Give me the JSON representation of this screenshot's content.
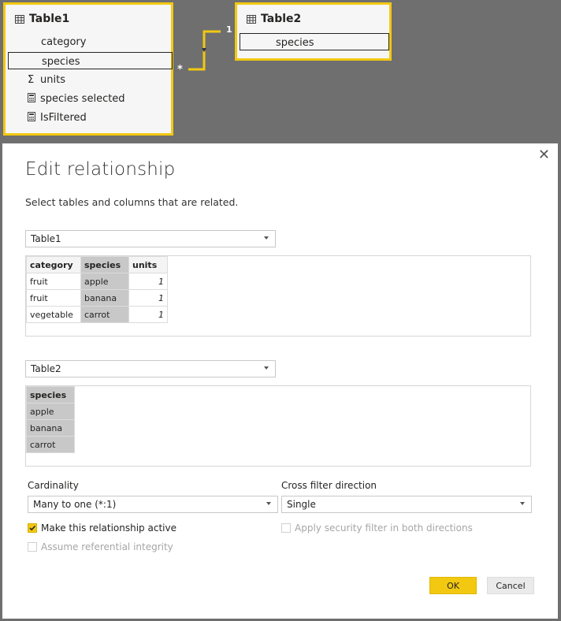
{
  "diagram": {
    "table1": {
      "title": "Table1",
      "fields": [
        {
          "label": "category",
          "icon": "none"
        },
        {
          "label": "species",
          "icon": "none",
          "selected": true
        },
        {
          "label": "units",
          "icon": "sigma-icon"
        },
        {
          "label": "species selected",
          "icon": "calculator-icon"
        },
        {
          "label": "IsFiltered",
          "icon": "calculator-icon"
        }
      ]
    },
    "table2": {
      "title": "Table2",
      "fields": [
        {
          "label": "species",
          "icon": "none",
          "selected": true
        }
      ]
    },
    "relationship": {
      "one_side": "1",
      "many_side": "*"
    },
    "accent_color": "#F2C811"
  },
  "dialog": {
    "title": "Edit relationship",
    "subtitle": "Select tables and columns that are related.",
    "close_glyph": "✕",
    "table1_select": "Table1",
    "table1_preview": {
      "columns": [
        "category",
        "species",
        "units"
      ],
      "selected_column": "species",
      "rows": [
        [
          "fruit",
          "apple",
          "1"
        ],
        [
          "fruit",
          "banana",
          "1"
        ],
        [
          "vegetable",
          "carrot",
          "1"
        ]
      ]
    },
    "table2_select": "Table2",
    "table2_preview": {
      "columns": [
        "species"
      ],
      "selected_column": "species",
      "rows": [
        [
          "apple"
        ],
        [
          "banana"
        ],
        [
          "carrot"
        ]
      ]
    },
    "cardinality": {
      "label": "Cardinality",
      "value": "Many to one (*:1)"
    },
    "cross_filter": {
      "label": "Cross filter direction",
      "value": "Single"
    },
    "options": {
      "make_active": {
        "label": "Make this relationship active",
        "checked": true,
        "enabled": true
      },
      "security_filter": {
        "label": "Apply security filter in both directions",
        "checked": false,
        "enabled": false
      },
      "referential_integrity": {
        "label": "Assume referential integrity",
        "checked": false,
        "enabled": false
      }
    },
    "ok_label": "OK",
    "cancel_label": "Cancel"
  }
}
